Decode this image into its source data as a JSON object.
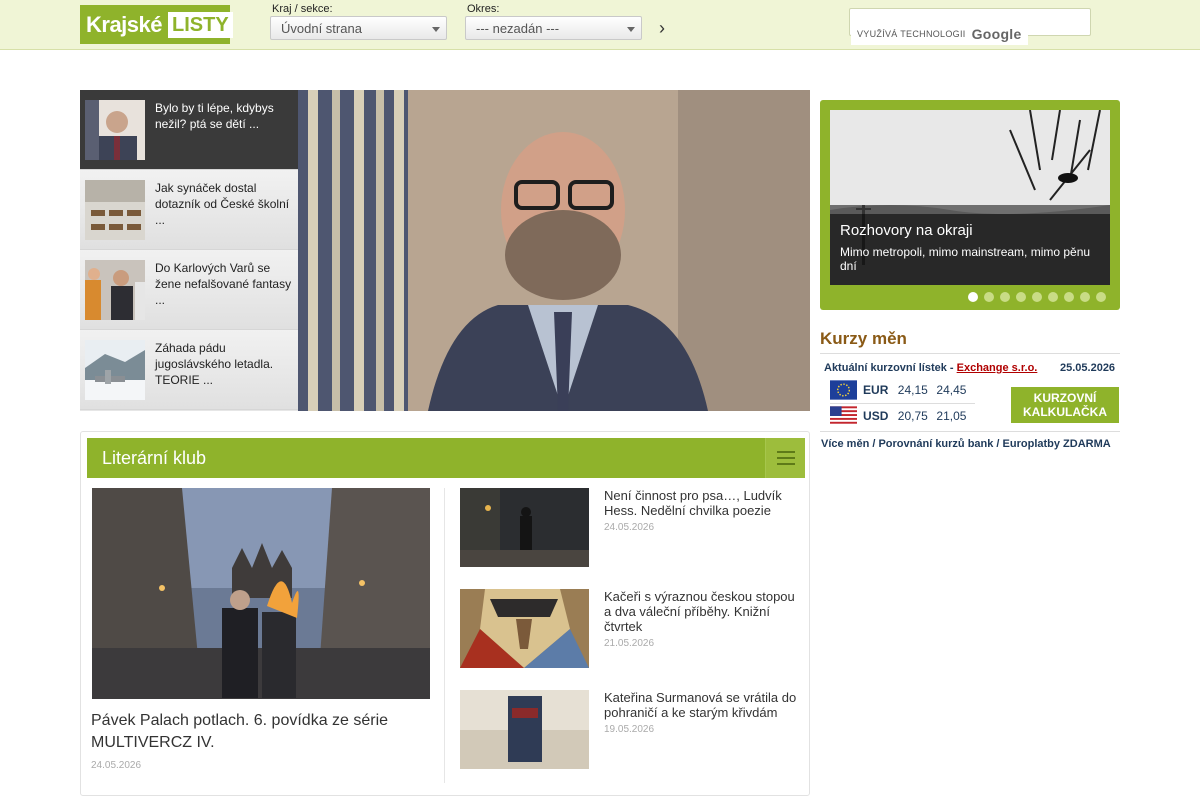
{
  "header": {
    "logo_part1": "Krajské",
    "logo_part2": "LISTY",
    "region_label": "Kraj / sekce:",
    "region_value": "Úvodní strana",
    "district_label": "Okres:",
    "district_value": "--- nezadán ---",
    "search_powered": "VYUŽÍVÁ TECHNOLOGII",
    "search_brand": "Google"
  },
  "carousel": {
    "items": [
      {
        "title": "Bylo by ti lépe, kdybys nežil? ptá se dětí ..."
      },
      {
        "title": "Jak synáček dostal dotazník od České školní ..."
      },
      {
        "title": "Do Karlových Varů se žene nefalšované fantasy ..."
      },
      {
        "title": "Záhada pádu jugoslávského letadla. TEORIE ..."
      }
    ]
  },
  "promo": {
    "title": "Rozhovory na okraji",
    "subtitle": "Mimo metropoli, mimo mainstream, mimo pěnu dní"
  },
  "rates": {
    "title": "Kurzy měn",
    "header_text": "Aktuální kurzovní lístek - ",
    "provider": "Exchange s.r.o.",
    "date": "25.05.2026",
    "rows": [
      {
        "currency": "EUR",
        "buy": "24,15",
        "sell": "24,45"
      },
      {
        "currency": "USD",
        "buy": "20,75",
        "sell": "21,05"
      }
    ],
    "calc_button": "KURZOVNÍ KALKULAČKA",
    "links": "Více měn / Porovnání kurzů bank / Europlatby ZDARMA"
  },
  "literary": {
    "title": "Literární klub",
    "featured": {
      "title": "Pávek Palach potlach. 6. povídka ze série MULTIVERCZ IV.",
      "date": "24.05.2026"
    },
    "articles": [
      {
        "title": "Není činnost pro psa…, Ludvík Hess. Nedělní chvilka poezie",
        "date": "24.05.2026"
      },
      {
        "title": "Kačeři s výraznou českou stopou a dva váleční příběhy. Knižní čtvrtek",
        "date": "21.05.2026"
      },
      {
        "title": "Kateřina Surmanová se vrátila do pohraničí a ke starým křivdám",
        "date": "19.05.2026"
      }
    ]
  }
}
